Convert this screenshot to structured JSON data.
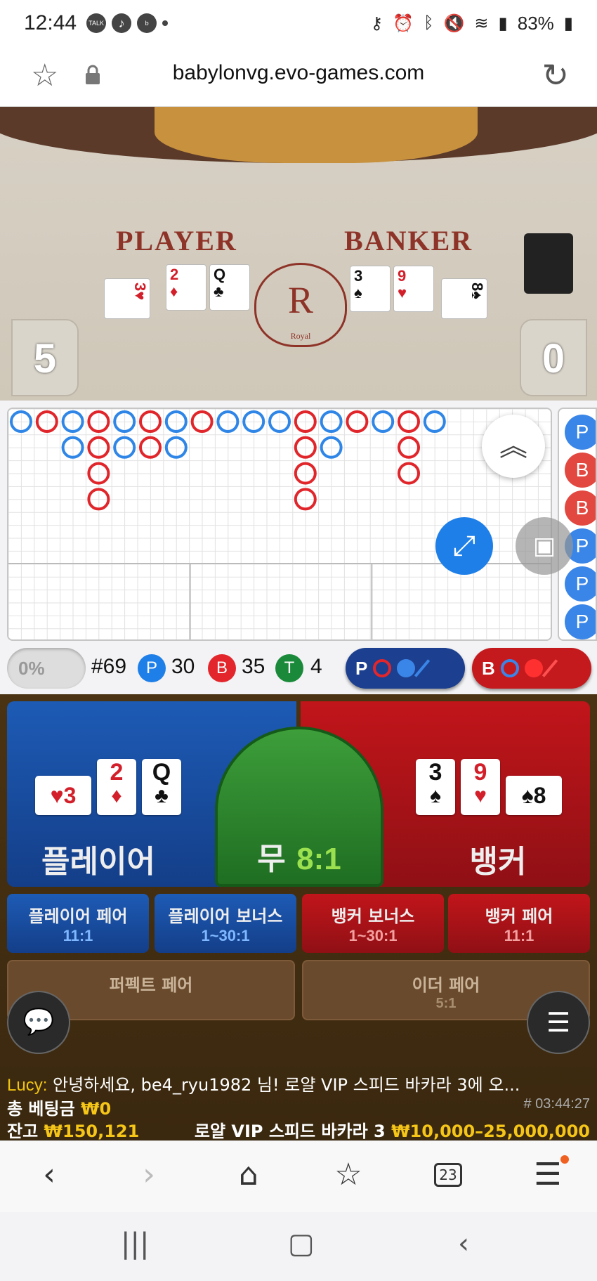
{
  "status_bar": {
    "time": "12:44",
    "battery": "83%",
    "apps": [
      "TALK",
      "TikTok",
      "b"
    ]
  },
  "browser": {
    "url": "babylonvg.evo-games.com"
  },
  "video": {
    "player_label": "PLAYER",
    "banker_label": "BANKER",
    "emblem_letter": "R",
    "emblem_text": "Royal",
    "player_score": "5",
    "banker_score": "0",
    "player_cards": [
      {
        "rank": "3",
        "suit": "♥",
        "color": "red"
      },
      {
        "rank": "2",
        "suit": "♦",
        "color": "red"
      },
      {
        "rank": "Q",
        "suit": "♣",
        "color": "black"
      }
    ],
    "banker_cards": [
      {
        "rank": "3",
        "suit": "♠",
        "color": "black"
      },
      {
        "rank": "9",
        "suit": "♥",
        "color": "red"
      },
      {
        "rank": "8",
        "suit": "♠",
        "color": "black"
      }
    ]
  },
  "roadmap": {
    "big_road": [
      [
        "P"
      ],
      [
        "B"
      ],
      [
        "P",
        "P"
      ],
      [
        "B",
        "B",
        "B",
        "B"
      ],
      [
        "P",
        "P"
      ],
      [
        "B",
        "B"
      ],
      [
        "P",
        "P"
      ],
      [
        "B"
      ],
      [
        "P"
      ],
      [
        "P"
      ],
      [
        "P"
      ],
      [
        "B",
        "B",
        "B",
        "B"
      ],
      [
        "P",
        "P"
      ],
      [
        "B"
      ],
      [
        "P"
      ],
      [
        "B",
        "B",
        "B"
      ],
      [
        "P"
      ]
    ],
    "side_column": [
      "P",
      "B",
      "B",
      "P",
      "P",
      "P"
    ]
  },
  "stats": {
    "percent": "0%",
    "shoe_number": "#69",
    "player_count": "30",
    "banker_count": "35",
    "tie_count": "4",
    "p_letter": "P",
    "b_letter": "B",
    "t_letter": "T"
  },
  "betting": {
    "player_label": "플레이어",
    "banker_label": "뱅커",
    "tie_label": "무",
    "tie_odds": "8:1",
    "player_hand": [
      {
        "rank": "3",
        "suit": "♥",
        "color": "red"
      },
      {
        "rank": "2",
        "suit": "♦",
        "color": "red"
      },
      {
        "rank": "Q",
        "suit": "♣",
        "color": "black"
      }
    ],
    "banker_hand": [
      {
        "rank": "3",
        "suit": "♠",
        "color": "black"
      },
      {
        "rank": "9",
        "suit": "♥",
        "color": "red"
      },
      {
        "rank": "8",
        "suit": "♠",
        "color": "black"
      }
    ],
    "side_bets": [
      {
        "label": "플레이어 페어",
        "odds": "11:1"
      },
      {
        "label": "플레이어 보너스",
        "odds": "1~30:1"
      },
      {
        "label": "뱅커 보너스",
        "odds": "1~30:1"
      },
      {
        "label": "뱅커 페어",
        "odds": "11:1"
      }
    ],
    "perfect_pair": {
      "label": "퍼펙트 페어",
      "odds": ""
    },
    "either_pair": {
      "label": "이더 페어",
      "odds": "5:1"
    }
  },
  "footer": {
    "chat_user": "Lucy:",
    "chat_message": "안녕하세요, be4_ryu1982 님! 로얄 VIP 스피드 바카라 3에 오...",
    "total_bet_label": "총 베팅금",
    "total_bet_value": "₩0",
    "round_id": "# 03:44:27",
    "balance_label": "잔고",
    "balance_value": "₩150,121",
    "table_name": "로얄 VIP 스피드 바카라 3",
    "limits": "₩10,000–25,000,000"
  },
  "browser_nav": {
    "tabs_count": "23"
  },
  "colors": {
    "player_blue": "#1d5bb5",
    "banker_red": "#c1151a",
    "tie_green": "#3d9e3a",
    "gold": "#f5c518"
  }
}
